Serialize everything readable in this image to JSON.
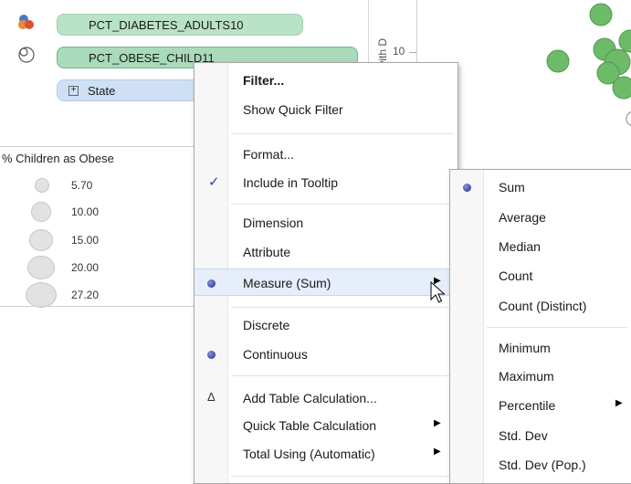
{
  "marks": {
    "pills": [
      {
        "label": "PCT_DIABETES_ADULTS10"
      },
      {
        "label": "PCT_OBESE_CHILD11"
      },
      {
        "label": "State"
      }
    ]
  },
  "chart": {
    "axis_label": "ts with D",
    "tick": "10"
  },
  "legend": {
    "title": "% Children as Obese",
    "items": [
      {
        "value": "5.70"
      },
      {
        "value": "10.00"
      },
      {
        "value": "15.00"
      },
      {
        "value": "20.00"
      },
      {
        "value": "27.20"
      }
    ]
  },
  "context_menu": {
    "items": [
      {
        "label": "Filter...",
        "bold": true
      },
      {
        "label": "Show Quick Filter"
      },
      {
        "label": "Format..."
      },
      {
        "label": "Include in Tooltip",
        "mark": "check"
      },
      {
        "label": "Dimension"
      },
      {
        "label": "Attribute"
      },
      {
        "label": "Measure (Sum)",
        "mark": "dot",
        "submenu": true,
        "highlighted": true
      },
      {
        "label": "Discrete"
      },
      {
        "label": "Continuous",
        "mark": "dot"
      },
      {
        "label": "Add Table Calculation...",
        "mark": "delta"
      },
      {
        "label": "Quick Table Calculation",
        "submenu": true
      },
      {
        "label": "Total Using (Automatic)",
        "submenu": true
      }
    ]
  },
  "aggregation_menu": {
    "items": [
      {
        "label": "Sum",
        "mark": "dot"
      },
      {
        "label": "Average"
      },
      {
        "label": "Median"
      },
      {
        "label": "Count"
      },
      {
        "label": "Count (Distinct)"
      },
      {
        "label": "Minimum"
      },
      {
        "label": "Maximum"
      },
      {
        "label": "Percentile",
        "submenu": true
      },
      {
        "label": "Std. Dev"
      },
      {
        "label": "Std. Dev (Pop.)"
      }
    ]
  },
  "colors": {
    "pill_green": "#b9e2c6",
    "pill_blue": "#cfe0f5",
    "bubble_green": "#5db560",
    "radio_dot": "#3c46a8",
    "check": "#1f4f9b"
  }
}
